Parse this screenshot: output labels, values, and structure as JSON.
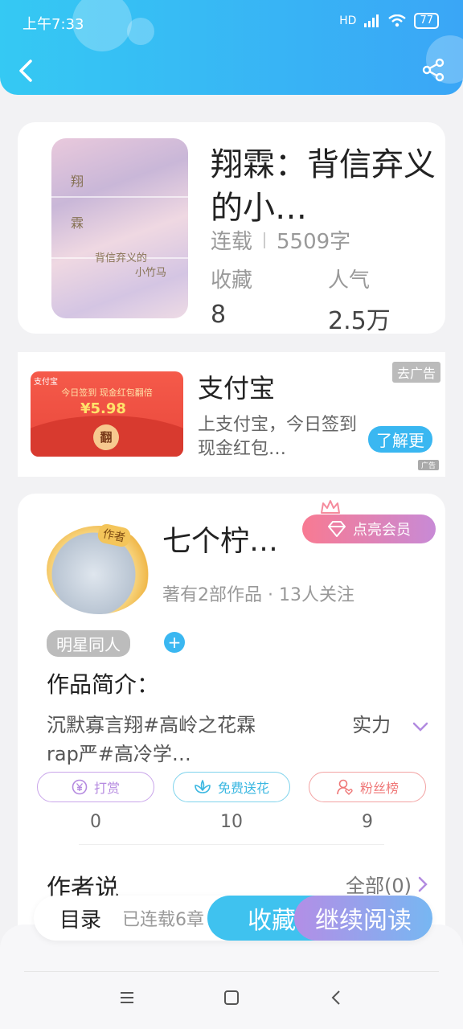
{
  "status_bar": {
    "time": "上午7:33",
    "network": "HD",
    "battery": "77"
  },
  "header": {
    "back_icon": "chevron-left-icon",
    "share_icon": "share-icon"
  },
  "book": {
    "title": "翔霖：背信弃义的小…",
    "status": "连载",
    "word_count": "5509字",
    "favorites_label": "收藏",
    "favorites_value": "8",
    "popularity_label": "人气",
    "popularity_value": "2.5万"
  },
  "ad": {
    "image_logo": "支付宝",
    "image_line1": "今日签到 现金红包翻倍",
    "image_amount": "¥5.98",
    "image_coin": "翻",
    "title": "支付宝",
    "description": "上支付宝，今日签到现金红包…",
    "remove_ad_label": "去广告",
    "cta_label": "了解更",
    "ad_mark": "广告"
  },
  "author": {
    "avatar_tag": "作者",
    "name": "七个柠…",
    "vip_label": "点亮会员",
    "meta": "著有2部作品 · 13人关注",
    "category_chip": "明星同人",
    "intro_heading": "作品简介：",
    "intro_text": "沉默寡言翔#高岭之花霖　　　　　实力rap严#高冷学…",
    "reward_label": "打赏",
    "reward_count": "0",
    "flower_label": "免费送花",
    "flower_count": "10",
    "fans_label": "粉丝榜",
    "fans_count": "9",
    "author_says_label": "作者说",
    "all_label": "全部(0)"
  },
  "bottom_bar": {
    "toc_label": "目录",
    "toc_status": "已连载6章",
    "favorite_button": "收藏",
    "continue_button": "继续阅读"
  },
  "colors": {
    "header_start": "#35c9f3",
    "header_end": "#3aa6f6",
    "accent_blue": "#3ab7f1",
    "vip_pink": "#f87a92",
    "vip_purple": "#c88ad6"
  }
}
